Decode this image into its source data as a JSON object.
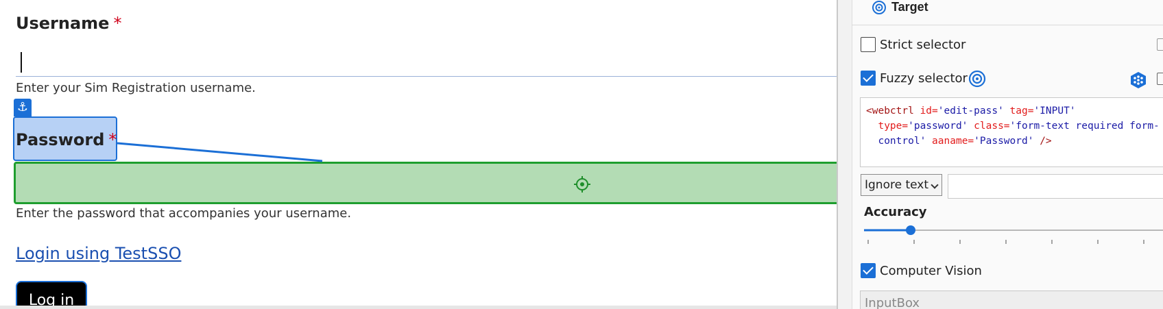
{
  "form": {
    "username_label": "Username",
    "required_mark": "*",
    "username_help": "Enter your Sim Registration username.",
    "password_label": "Password",
    "password_help": "Enter the password that accompanies your username.",
    "sso_link": "Login using TestSSO",
    "login_button": "Log in"
  },
  "panel": {
    "target_title": "Target",
    "strict_selector": {
      "label": "Strict selector",
      "checked": false
    },
    "fuzzy_selector": {
      "label": "Fuzzy selector",
      "checked": true
    },
    "selector_code": {
      "line1_tag": "<webctrl",
      "line1_a1": " id=",
      "line1_v1": "'edit-pass'",
      "line1_a2": " tag=",
      "line1_v2": "'INPUT'",
      "line2_a1": "  type=",
      "line2_v1": "'password'",
      "line2_a2": " class=",
      "line2_v2": "'form-text required form-",
      "line3_v1": "  control'",
      "line3_a1": " aaname=",
      "line3_v2": "'Password'",
      "line3_end": " />"
    },
    "ignore_text": "Ignore text",
    "accuracy_label": "Accuracy",
    "accuracy_value": 0.15,
    "computer_vision": {
      "label": "Computer Vision",
      "checked": true
    },
    "cv_element_type": "InputBox"
  },
  "icons": {
    "anchor": "anchor-icon",
    "target": "target-icon",
    "crosshair": "crosshair-icon",
    "cube": "cube-icon",
    "copy": "copy-icon"
  },
  "colors": {
    "accent": "#1b6fd6",
    "match_fill": "#b3dcb4",
    "match_border": "#1e9e2e",
    "anchor_fill": "#b7d1f5",
    "required": "#d0021b",
    "link": "#1a4fb0"
  }
}
